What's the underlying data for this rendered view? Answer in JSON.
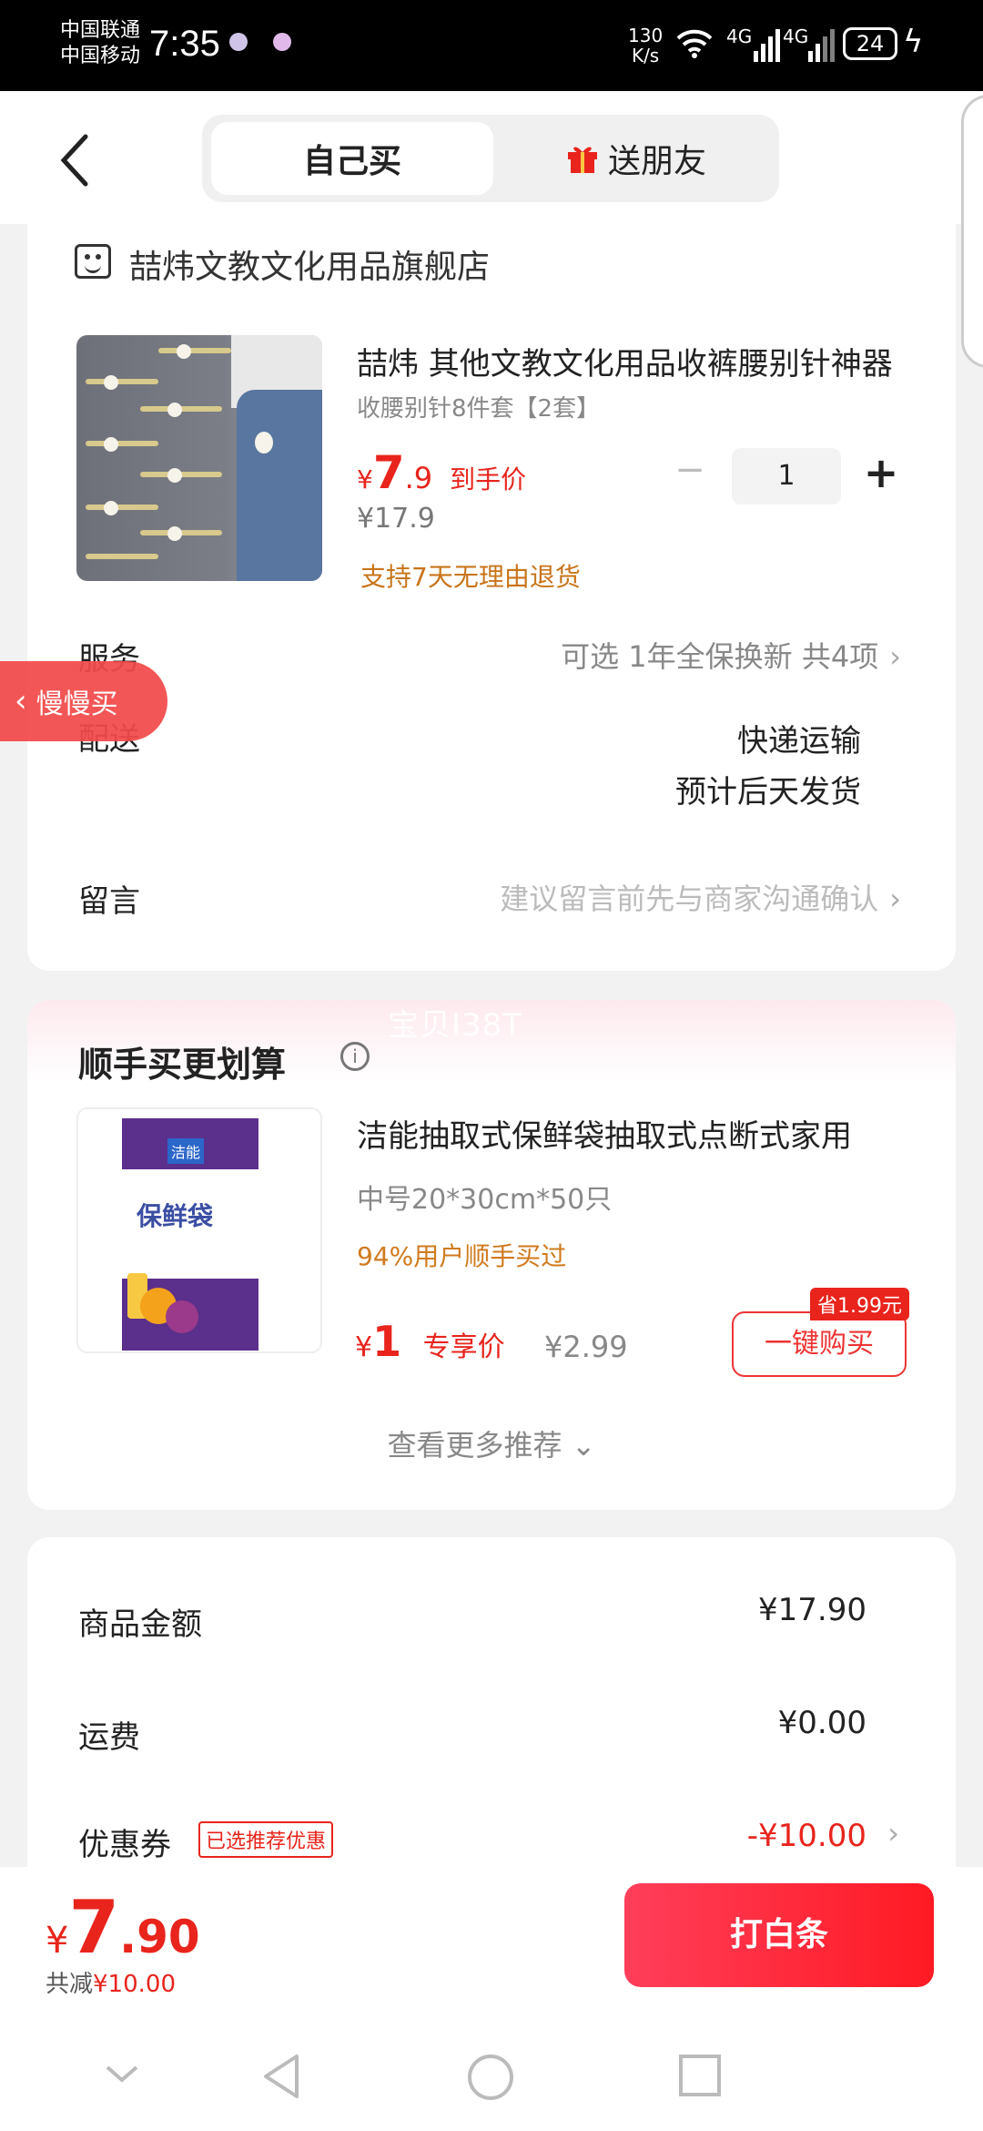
{
  "status_bar": {
    "carrier_1": "中国联通",
    "carrier_2": "中国移动",
    "time": "7:35",
    "speed_value": "130",
    "speed_unit": "K/s",
    "network_1": "4G",
    "network_2": "4G",
    "battery": "24"
  },
  "header": {
    "tab_self": "自己买",
    "tab_gift": "送朋友"
  },
  "store": {
    "name": "喆炜文教文化用品旗舰店"
  },
  "product": {
    "title": "喆炜 其他文教文化用品收裤腰别针神器",
    "sku": "收腰别针8件套【2套】",
    "currency": "¥",
    "price_int": "7",
    "price_dec": ".9",
    "price_label": "到手价",
    "original_price": "¥17.9",
    "return_policy": "支持7天无理由退货",
    "quantity": "1",
    "minus": "−",
    "plus": "+"
  },
  "service": {
    "label": "服务",
    "value": "可选 1年全保换新 共4项"
  },
  "slow_buy": {
    "label": "慢慢买"
  },
  "delivery": {
    "label": "配送",
    "method": "快递运输",
    "eta": "预计后天发货"
  },
  "message": {
    "label": "留言",
    "placeholder": "建议留言前先与商家沟通确认"
  },
  "recommend": {
    "title": "顺手买更划算",
    "watermark": "宝贝I38T",
    "item_title": "洁能抽取式保鲜袋抽取式点断式家用",
    "spec": "中号20*30cm*50只",
    "stat": "94%用户顺手买过",
    "currency": "¥",
    "price": "1",
    "price_label": "专享价",
    "original_price": "¥2.99",
    "save_tag": "省1.99元",
    "buy_button": "一键购买",
    "more": "查看更多推荐"
  },
  "summary": {
    "goods_label": "商品金额",
    "goods_value": "¥17.90",
    "shipping_label": "运费",
    "shipping_value": "¥0.00",
    "coupon_label": "优惠券",
    "coupon_tag": "已选推荐优惠",
    "coupon_value": "-¥10.00"
  },
  "checkout": {
    "currency": "¥",
    "total_int": "7",
    "total_dec": ".90",
    "saved_label": "共减",
    "saved_value": "¥10.00",
    "pay_button": "打白条"
  }
}
